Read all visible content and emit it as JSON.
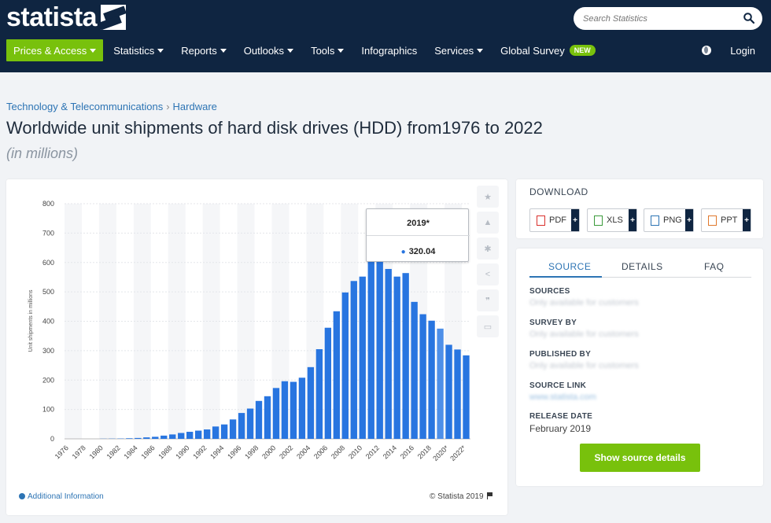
{
  "header": {
    "logo_text": "statista",
    "search_placeholder": "Search Statistics",
    "nav": [
      {
        "label": "Prices & Access",
        "has_caret": true
      },
      {
        "label": "Statistics",
        "has_caret": true
      },
      {
        "label": "Reports",
        "has_caret": true
      },
      {
        "label": "Outlooks",
        "has_caret": true
      },
      {
        "label": "Tools",
        "has_caret": true
      },
      {
        "label": "Infographics",
        "has_caret": false
      },
      {
        "label": "Services",
        "has_caret": true
      },
      {
        "label": "Global Survey",
        "has_caret": false
      }
    ],
    "new_badge": "NEW",
    "login": "Login"
  },
  "breadcrumb": {
    "category": "Technology & Telecommunications",
    "separator": "›",
    "subcategory": "Hardware"
  },
  "page": {
    "title": "Worldwide unit shipments of hard disk drives (HDD) from1976 to 2022",
    "subtitle": "(in millions)"
  },
  "chart_data": {
    "type": "bar",
    "ylabel": "Unit shipments in millions",
    "ylim": [
      0,
      800
    ],
    "yticks": [
      0,
      100,
      200,
      300,
      400,
      500,
      600,
      700,
      800
    ],
    "x_tick_labels": [
      "1976",
      "1978",
      "1980",
      "1982",
      "1984",
      "1986",
      "1988",
      "1990",
      "1992",
      "1994",
      "1996",
      "1998",
      "2000",
      "2002",
      "2004",
      "2006",
      "2008",
      "2010",
      "2012",
      "2014",
      "2016",
      "2018",
      "2020*",
      "2022*"
    ],
    "categories": [
      "1976",
      "1977",
      "1978",
      "1979",
      "1980",
      "1981",
      "1982",
      "1983",
      "1984",
      "1985",
      "1986",
      "1987",
      "1988",
      "1989",
      "1990",
      "1991",
      "1992",
      "1993",
      "1994",
      "1995",
      "1996",
      "1997",
      "1998",
      "1999",
      "2000",
      "2001",
      "2002",
      "2003",
      "2004",
      "2005",
      "2006",
      "2007",
      "2008",
      "2009",
      "2010",
      "2011",
      "2012",
      "2013",
      "2014",
      "2015",
      "2016",
      "2017",
      "2018",
      "2019*",
      "2020*",
      "2021*",
      "2022*"
    ],
    "values": [
      0,
      0,
      0,
      0,
      0.5,
      0.7,
      1,
      2,
      3,
      5,
      7,
      11,
      15,
      20,
      24,
      28,
      32,
      42,
      49,
      66,
      88,
      103,
      129,
      145,
      173,
      196,
      194,
      208,
      244,
      305,
      378,
      434,
      498,
      537,
      552,
      650,
      625,
      578,
      552,
      564,
      466,
      424,
      402,
      375,
      320,
      304,
      284
    ],
    "highlight_index": 43,
    "grid": true,
    "color": "#2875e0",
    "forecast_color": "#4e8fe8"
  },
  "tooltip": {
    "year": "2019*",
    "value": "320.04"
  },
  "chart_footer": {
    "additional_info": "Additional Information",
    "copyright": "© Statista 2019"
  },
  "download": {
    "title": "DOWNLOAD",
    "buttons": [
      {
        "label": "PDF",
        "color": "#d9302c"
      },
      {
        "label": "XLS",
        "color": "#3a9a3a"
      },
      {
        "label": "PNG",
        "color": "#2d74b4"
      },
      {
        "label": "PPT",
        "color": "#e0782c"
      }
    ]
  },
  "source_panel": {
    "tabs": [
      "SOURCE",
      "DETAILS",
      "FAQ"
    ],
    "sources_label": "SOURCES",
    "sources_value": "Only available for customers",
    "survey_by_label": "SURVEY BY",
    "survey_by_value": "Only available for customers",
    "published_by_label": "PUBLISHED BY",
    "published_by_value": "Only available for customers",
    "source_link_label": "SOURCE LINK",
    "source_link_value": "www.statista.com",
    "release_date_label": "RELEASE DATE",
    "release_date_value": "February 2019",
    "button": "Show source details"
  }
}
